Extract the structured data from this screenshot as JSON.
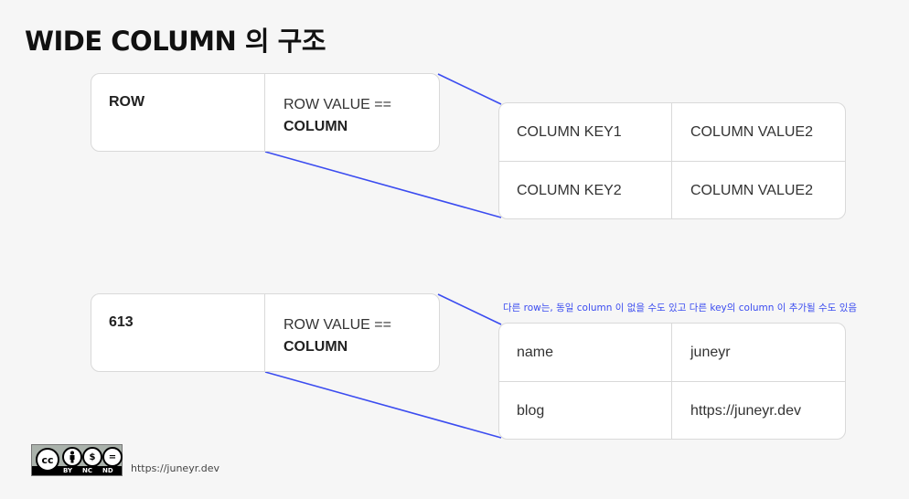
{
  "title": "WIDE COLUMN 의 구조",
  "diagrams": [
    {
      "row_key": "ROW",
      "row_value_line1": "ROW VALUE ==",
      "row_value_line2": "COLUMN",
      "columns": [
        {
          "key": "COLUMN KEY1",
          "value": "COLUMN VALUE2"
        },
        {
          "key": "COLUMN KEY2",
          "value": "COLUMN VALUE2"
        }
      ]
    },
    {
      "row_key": "613",
      "row_value_line1": "ROW VALUE ==",
      "row_value_line2": "COLUMN",
      "note": "다른 row는, 동일 column 이 없을 수도 있고 다른 key의 column 이 추가될 수도 있음",
      "columns": [
        {
          "key": "name",
          "value": "juneyr"
        },
        {
          "key": "blog",
          "value": "https://juneyr.dev"
        }
      ]
    }
  ],
  "license": {
    "badge_text": "cc",
    "labels": [
      "BY",
      "NC",
      "ND"
    ],
    "url": "https://juneyr.dev"
  },
  "colors": {
    "connector": "#3b4cf0",
    "note": "#3b4cf0"
  }
}
